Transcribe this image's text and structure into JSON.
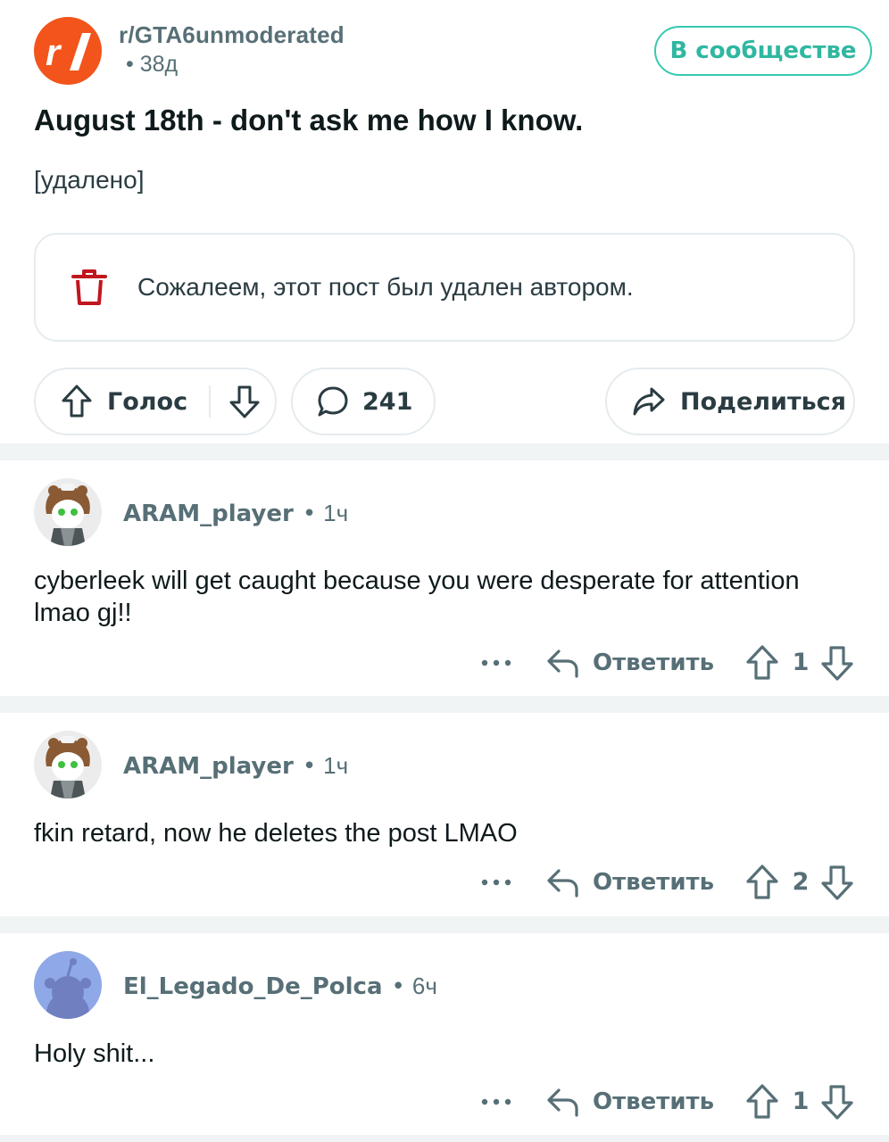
{
  "post": {
    "subreddit": "r/GTA6unmoderated",
    "age": "• 38д",
    "join_label": "В сообществе",
    "title": "August 18th - don't ask me how I know.",
    "body": "[удалено]",
    "deleted_notice": "Сожалеем, этот пост был удален автором.",
    "vote_label": "Голос",
    "comment_count": "241",
    "share_label": "Поделиться"
  },
  "colors": {
    "brand_orange": "#f2541b",
    "join_teal": "#36c9b1",
    "trash_red": "#c0161d",
    "meta_gray": "#576f76"
  },
  "comments": [
    {
      "user": "ARAM_player",
      "dot": "•",
      "time": "1ч",
      "text": "cyberleek will get caught because you were desperate for attention lmao gj!!",
      "reply_label": "Ответить",
      "score": "1"
    },
    {
      "user": "ARAM_player",
      "dot": "•",
      "time": "1ч",
      "text": "fkin retard, now he deletes the post LMAO",
      "reply_label": "Ответить",
      "score": "2"
    },
    {
      "user": "El_Legado_De_Polca",
      "dot": "•",
      "time": "6ч",
      "text": "Holy shit...",
      "reply_label": "Ответить",
      "score": "1"
    }
  ],
  "icons": {
    "subreddit": "subreddit-logo-icon",
    "trash": "trash-icon",
    "upvote": "arrow-up-icon",
    "downvote": "arrow-down-icon",
    "comment": "speech-bubble-icon",
    "share": "share-arrow-icon",
    "more": "more-dots-icon",
    "reply": "reply-arrow-icon"
  }
}
